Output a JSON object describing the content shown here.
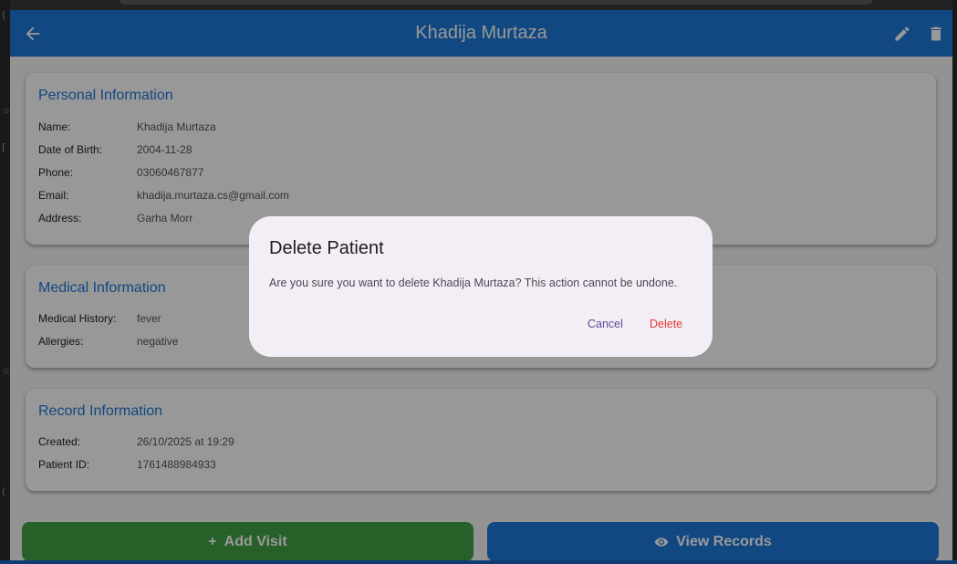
{
  "appbar": {
    "title": "Khadija Murtaza",
    "back_icon": "arrow-back-icon",
    "edit_icon": "pencil-icon",
    "delete_icon": "trash-icon",
    "color": "#1e78d7"
  },
  "personal": {
    "title": "Personal Information",
    "rows": [
      {
        "label": "Name:",
        "value": "Khadija Murtaza"
      },
      {
        "label": "Date of Birth:",
        "value": "2004-11-28"
      },
      {
        "label": "Phone:",
        "value": "03060467877"
      },
      {
        "label": "Email:",
        "value": "khadija.murtaza.cs@gmail.com"
      },
      {
        "label": "Address:",
        "value": "Garha Morr"
      }
    ]
  },
  "medical": {
    "title": "Medical Information",
    "rows": [
      {
        "label": "Medical History:",
        "value": "fever"
      },
      {
        "label": "Allergies:",
        "value": "negative"
      }
    ]
  },
  "record": {
    "title": "Record Information",
    "rows": [
      {
        "label": "Created:",
        "value": "26/10/2025 at 19:29"
      },
      {
        "label": "Patient ID:",
        "value": "1761488984933"
      }
    ]
  },
  "actions": {
    "add_visit": {
      "label": "Add Visit",
      "icon": "plus-icon",
      "color": "#43a047"
    },
    "view_records": {
      "label": "View Records",
      "icon": "eye-icon",
      "color": "#1e78d7"
    }
  },
  "dialog": {
    "title": "Delete Patient",
    "message": "Are you sure you want to delete Khadija Murtaza? This action cannot be undone.",
    "cancel_label": "Cancel",
    "delete_label": "Delete",
    "delete_color": "#e53935"
  }
}
